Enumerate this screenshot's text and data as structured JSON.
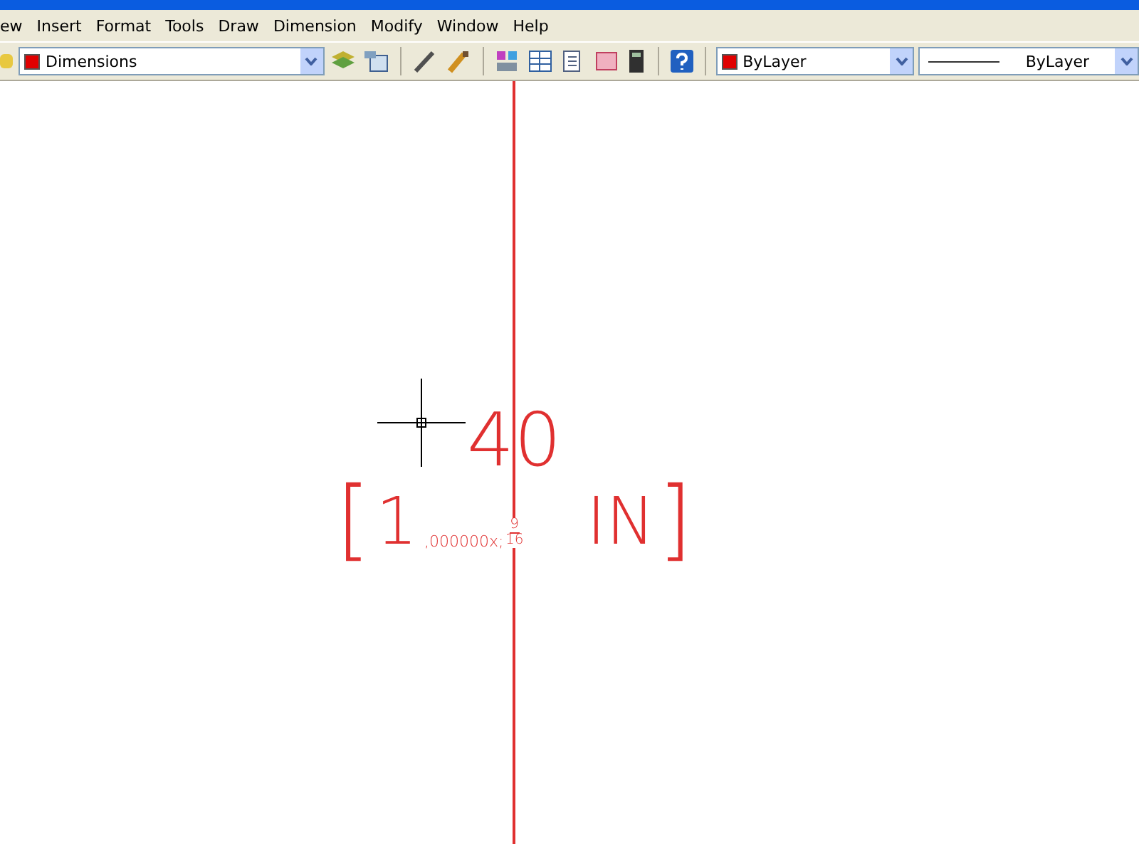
{
  "menu": [
    "ew",
    "Insert",
    "Format",
    "Tools",
    "Draw",
    "Dimension",
    "Modify",
    "Window",
    "Help"
  ],
  "toolbar": {
    "layer": {
      "value": "Dimensions",
      "color": "#e00000"
    },
    "color_combo": {
      "value": "ByLayer",
      "color": "#e00000"
    },
    "linetype_combo": {
      "value": "ByLayer"
    }
  },
  "drawing": {
    "value": "40",
    "open_bracket": "[",
    "main": "1",
    "small": ",000000x;",
    "numerator": "9",
    "denominator": "16",
    "unit": "IN",
    "close_bracket": "]"
  }
}
